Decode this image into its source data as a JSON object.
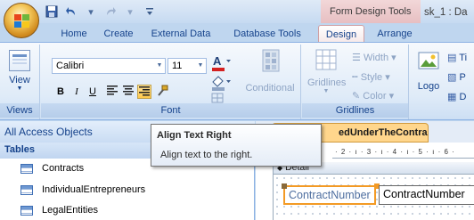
{
  "titlebar": {
    "context_tab_group": "Form Design Tools",
    "window_title": "sk_1 : Da",
    "qat": [
      {
        "name": "save",
        "glyph": "💾"
      },
      {
        "name": "undo",
        "glyph": "↶"
      },
      {
        "name": "undo-dropdown",
        "glyph": "▾"
      },
      {
        "name": "redo",
        "glyph": "↷"
      },
      {
        "name": "redo-dropdown",
        "glyph": "▾"
      },
      {
        "name": "customize",
        "glyph": "▾"
      }
    ]
  },
  "tabs": [
    "Home",
    "Create",
    "External Data",
    "Database Tools",
    "Design",
    "Arrange"
  ],
  "active_tab": "Design",
  "ribbon": {
    "views_group": "Views",
    "view_label": "View",
    "font_group": "Font",
    "font_name": "Calibri",
    "font_size": "11",
    "conditional": "Conditional",
    "gridlines_group": "Gridlines",
    "gridlines_label": "Gridlines",
    "width_label": "Width",
    "style_label": "Style",
    "color_label": "Color",
    "logo_label": "Logo",
    "title_partial": "Ti",
    "page_partial": "P",
    "date_partial": "D"
  },
  "nav": {
    "header": "All Access Objects",
    "section": "Tables",
    "items": [
      "Contracts",
      "IndividualEntrepreneurs",
      "LegalEntities"
    ]
  },
  "document": {
    "tab_label": "edUnderTheContract",
    "ruler": "· 2 · ı · 3 · ı · 4 · ı · 5 · ı · 6 ·",
    "section_label": "Detail",
    "field_label": "ContractNumber",
    "field_textbox": "ContractNumber"
  },
  "tooltip": {
    "title": "Align Text Right",
    "description": "Align text to the right."
  },
  "colors": {
    "ribbon_blue": "#bfd6ef",
    "context_tab": "#e7bfc2",
    "selection_orange": "#f39a25",
    "doc_tab": "#ffd68c"
  }
}
